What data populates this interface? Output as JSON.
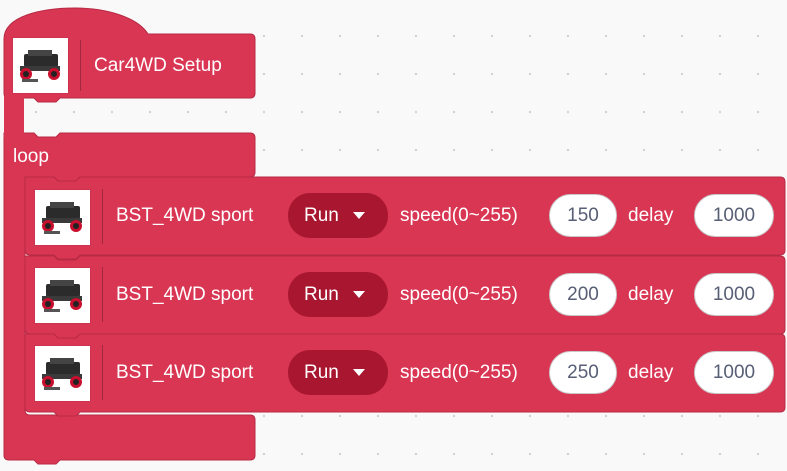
{
  "colors": {
    "block": "#d93654",
    "block_border": "#b62a44",
    "dropdown": "#a8162f",
    "field_text": "#575e75"
  },
  "setup_block": {
    "icon": "car-4wd-icon",
    "label": "Car4WD Setup"
  },
  "loop_block": {
    "label": "loop"
  },
  "sport_blocks": [
    {
      "icon": "car-4wd-icon",
      "label": "BST_4WD sport",
      "direction": "Run",
      "speed_label": "speed(0~255)",
      "speed": "150",
      "delay_label": "delay",
      "delay": "1000"
    },
    {
      "icon": "car-4wd-icon",
      "label": "BST_4WD sport",
      "direction": "Run",
      "speed_label": "speed(0~255)",
      "speed": "200",
      "delay_label": "delay",
      "delay": "1000"
    },
    {
      "icon": "car-4wd-icon",
      "label": "BST_4WD sport",
      "direction": "Run",
      "speed_label": "speed(0~255)",
      "speed": "250",
      "delay_label": "delay",
      "delay": "1000"
    }
  ]
}
